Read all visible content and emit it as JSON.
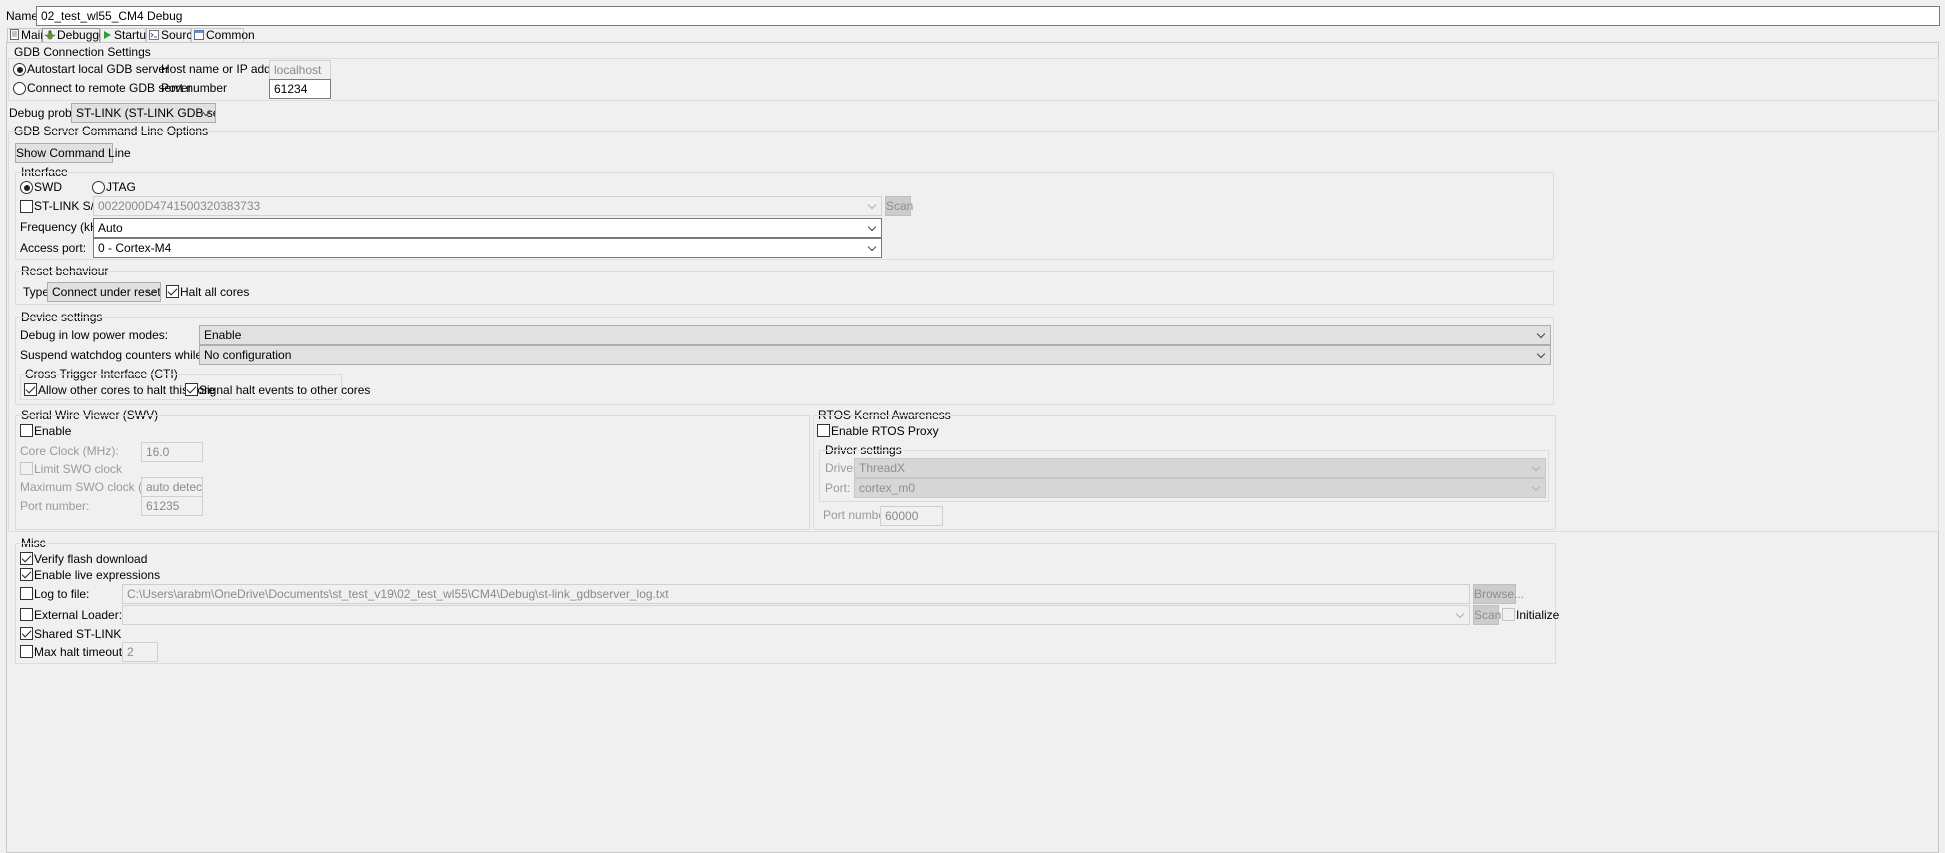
{
  "name": {
    "label": "Name:",
    "value": "02_test_wl55_CM4 Debug"
  },
  "tabs": [
    {
      "label": "Main",
      "icon": "document-icon"
    },
    {
      "label": "Debugger",
      "icon": "bug-icon"
    },
    {
      "label": "Startup",
      "icon": "play-icon"
    },
    {
      "label": "Source",
      "icon": "source-icon"
    },
    {
      "label": "Common",
      "icon": "window-icon"
    }
  ],
  "gdb_connection": {
    "title": "GDB Connection Settings",
    "autostart_label": "Autostart local GDB server",
    "remote_label": "Connect to remote GDB server",
    "host_label": "Host name or IP address",
    "host_value": "localhost",
    "port_label": "Port number",
    "port_value": "61234"
  },
  "debug_probe": {
    "label": "Debug probe",
    "value": "ST-LINK (ST-LINK GDB server)"
  },
  "cmdline": {
    "title": "GDB Server Command Line Options",
    "button": "Show Command Line"
  },
  "interface": {
    "title": "Interface",
    "swd": "SWD",
    "jtag": "JTAG",
    "stlink_sn_label": "ST-LINK S/N",
    "stlink_sn_value": "0022000D4741500320383733",
    "scan": "Scan",
    "frequency_label": "Frequency (kHz):",
    "frequency_value": "Auto",
    "access_port_label": "Access port:",
    "access_port_value": "0 - Cortex-M4"
  },
  "reset": {
    "title": "Reset behaviour",
    "type_label": "Type:",
    "type_value": "Connect under reset",
    "halt_all_label": "Halt all cores"
  },
  "device": {
    "title": "Device settings",
    "low_power_label": "Debug in low power modes:",
    "low_power_value": "Enable",
    "watchdog_label": "Suspend watchdog counters while halted:",
    "watchdog_value": "No configuration",
    "cti_title": "Cross Trigger Interface (CTI)",
    "cti_allow": "Allow other cores to halt this core",
    "cti_signal": "Signal halt events to other cores"
  },
  "swv": {
    "title": "Serial Wire Viewer (SWV)",
    "enable": "Enable",
    "core_clock_label": "Core Clock (MHz):",
    "core_clock_value": "16.0",
    "limit_swo": "Limit SWO clock",
    "max_swo_label": "Maximum SWO clock (kHz):",
    "max_swo_value": "auto detect",
    "port_label": "Port number:",
    "port_value": "61235"
  },
  "rtos": {
    "title": "RTOS Kernel Awareness",
    "enable": "Enable RTOS Proxy",
    "driver_settings": "Driver settings",
    "driver_label": "Driver:",
    "driver_value": "ThreadX",
    "port_label": "Port:",
    "port_value": "cortex_m0",
    "port_number_label": "Port number:",
    "port_number_value": "60000"
  },
  "misc": {
    "title": "Misc",
    "verify_flash": "Verify flash download",
    "live_expressions": "Enable live expressions",
    "log_to_file": "Log to file:",
    "log_path": "C:\\Users\\arabm\\OneDrive\\Documents\\st_test_v19\\02_test_wl55\\CM4\\Debug\\st-link_gdbserver_log.txt",
    "browse": "Browse...",
    "external_loader": "External Loader:",
    "scan": "Scan",
    "initialize": "Initialize",
    "shared_stlink": "Shared ST-LINK",
    "max_halt_label": "Max halt timeout(s):",
    "max_halt_value": "2"
  }
}
